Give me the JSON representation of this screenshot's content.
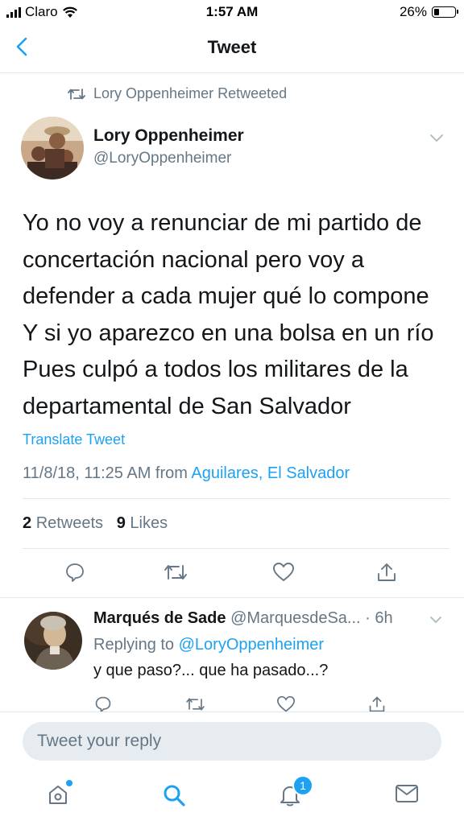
{
  "status_bar": {
    "carrier": "Claro",
    "time": "1:57 AM",
    "battery": "26%",
    "battery_level": 0.26
  },
  "nav": {
    "title": "Tweet",
    "back_icon": "chevron-left-icon"
  },
  "retweet_banner": {
    "text": "Lory Oppenheimer Retweeted",
    "icon": "retweet-icon"
  },
  "tweet": {
    "author_name": "Lory Oppenheimer",
    "author_handle": "@LoryOppenheimer",
    "lines": [
      "Yo no voy a renunciar de mi partido de",
      "concertación nacional pero voy a",
      "defender a cada mujer qué lo compone",
      "Y si yo aparezco en una bolsa en un río",
      "Pues culpó a todos los militares de la",
      "departamental de San Salvador"
    ],
    "translate_label": "Translate Tweet",
    "timestamp": "11/8/18, 11:25 AM from",
    "location": "Aguilares, El Salvador",
    "retweet_count": "2",
    "retweet_label": "Retweets",
    "like_count": "9",
    "like_label": "Likes"
  },
  "reply": {
    "author_name": "Marqués de Sade",
    "author_handle": "@MarquesdeSa... · 6h",
    "replying_prefix": "Replying to",
    "replying_to": "@LoryOppenheimer",
    "text": "y que paso?... que ha pasado...?"
  },
  "composer": {
    "placeholder": "Tweet your reply"
  },
  "tabbar": {
    "notifications_badge": "1"
  },
  "colors": {
    "accent": "#1da1f2",
    "secondary_text": "#657786",
    "divider": "#e1e8ed"
  }
}
